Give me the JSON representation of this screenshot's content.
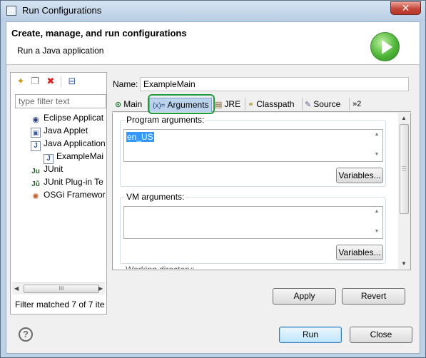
{
  "window": {
    "title": "Run Configurations",
    "close_glyph": "✕"
  },
  "header": {
    "title": "Create, manage, and run configurations",
    "subtitle": "Run a Java application",
    "logo_icon": "run-play-icon"
  },
  "left": {
    "toolbar_icons": [
      "new-configuration-icon",
      "duplicate-icon",
      "delete-icon",
      "collapse-all-icon"
    ],
    "filter_placeholder": "type filter text",
    "tree": [
      {
        "label": "Eclipse Applicat",
        "icon": "eclipse-icon",
        "level": 1
      },
      {
        "label": "Java Applet",
        "icon": "java-applet-icon",
        "level": 1
      },
      {
        "label": "Java Application",
        "icon": "java-application-icon",
        "level": 1
      },
      {
        "label": "ExampleMai",
        "icon": "java-file-icon",
        "level": 2
      },
      {
        "label": "JUnit",
        "icon": "junit-icon",
        "level": 1
      },
      {
        "label": "JUnit Plug-in Te",
        "icon": "junit-plugin-icon",
        "level": 1
      },
      {
        "label": "OSGi Framewor",
        "icon": "osgi-icon",
        "level": 1
      }
    ],
    "scroll_grip": "III",
    "status": "Filter matched 7 of 7 ite"
  },
  "config": {
    "name_label": "Name:",
    "name_value": "ExampleMain",
    "tabs": [
      {
        "label": "Main",
        "icon": "main-tab-icon",
        "active": false
      },
      {
        "label": "Arguments",
        "icon": "arguments-tab-icon",
        "icon_glyph": "(x)=",
        "active": true
      },
      {
        "label": "JRE",
        "icon": "jre-tab-icon",
        "active": false
      },
      {
        "label": "Classpath",
        "icon": "classpath-tab-icon",
        "active": false
      },
      {
        "label": "Source",
        "icon": "source-tab-icon",
        "active": false
      }
    ],
    "more_tabs": "»2",
    "program_args_label": "Program arguments:",
    "program_args_value": "en_US",
    "vm_args_label": "VM arguments:",
    "vm_args_value": "",
    "variables_label": "Variables...",
    "cutoff_label": "Working directory:"
  },
  "buttons": {
    "apply": "Apply",
    "revert": "Revert",
    "run": "Run",
    "close": "Close"
  },
  "colors": {
    "accent_tab": "#bcd3ee",
    "highlight_ring": "#1f9a3e",
    "selection": "#3399ff"
  }
}
